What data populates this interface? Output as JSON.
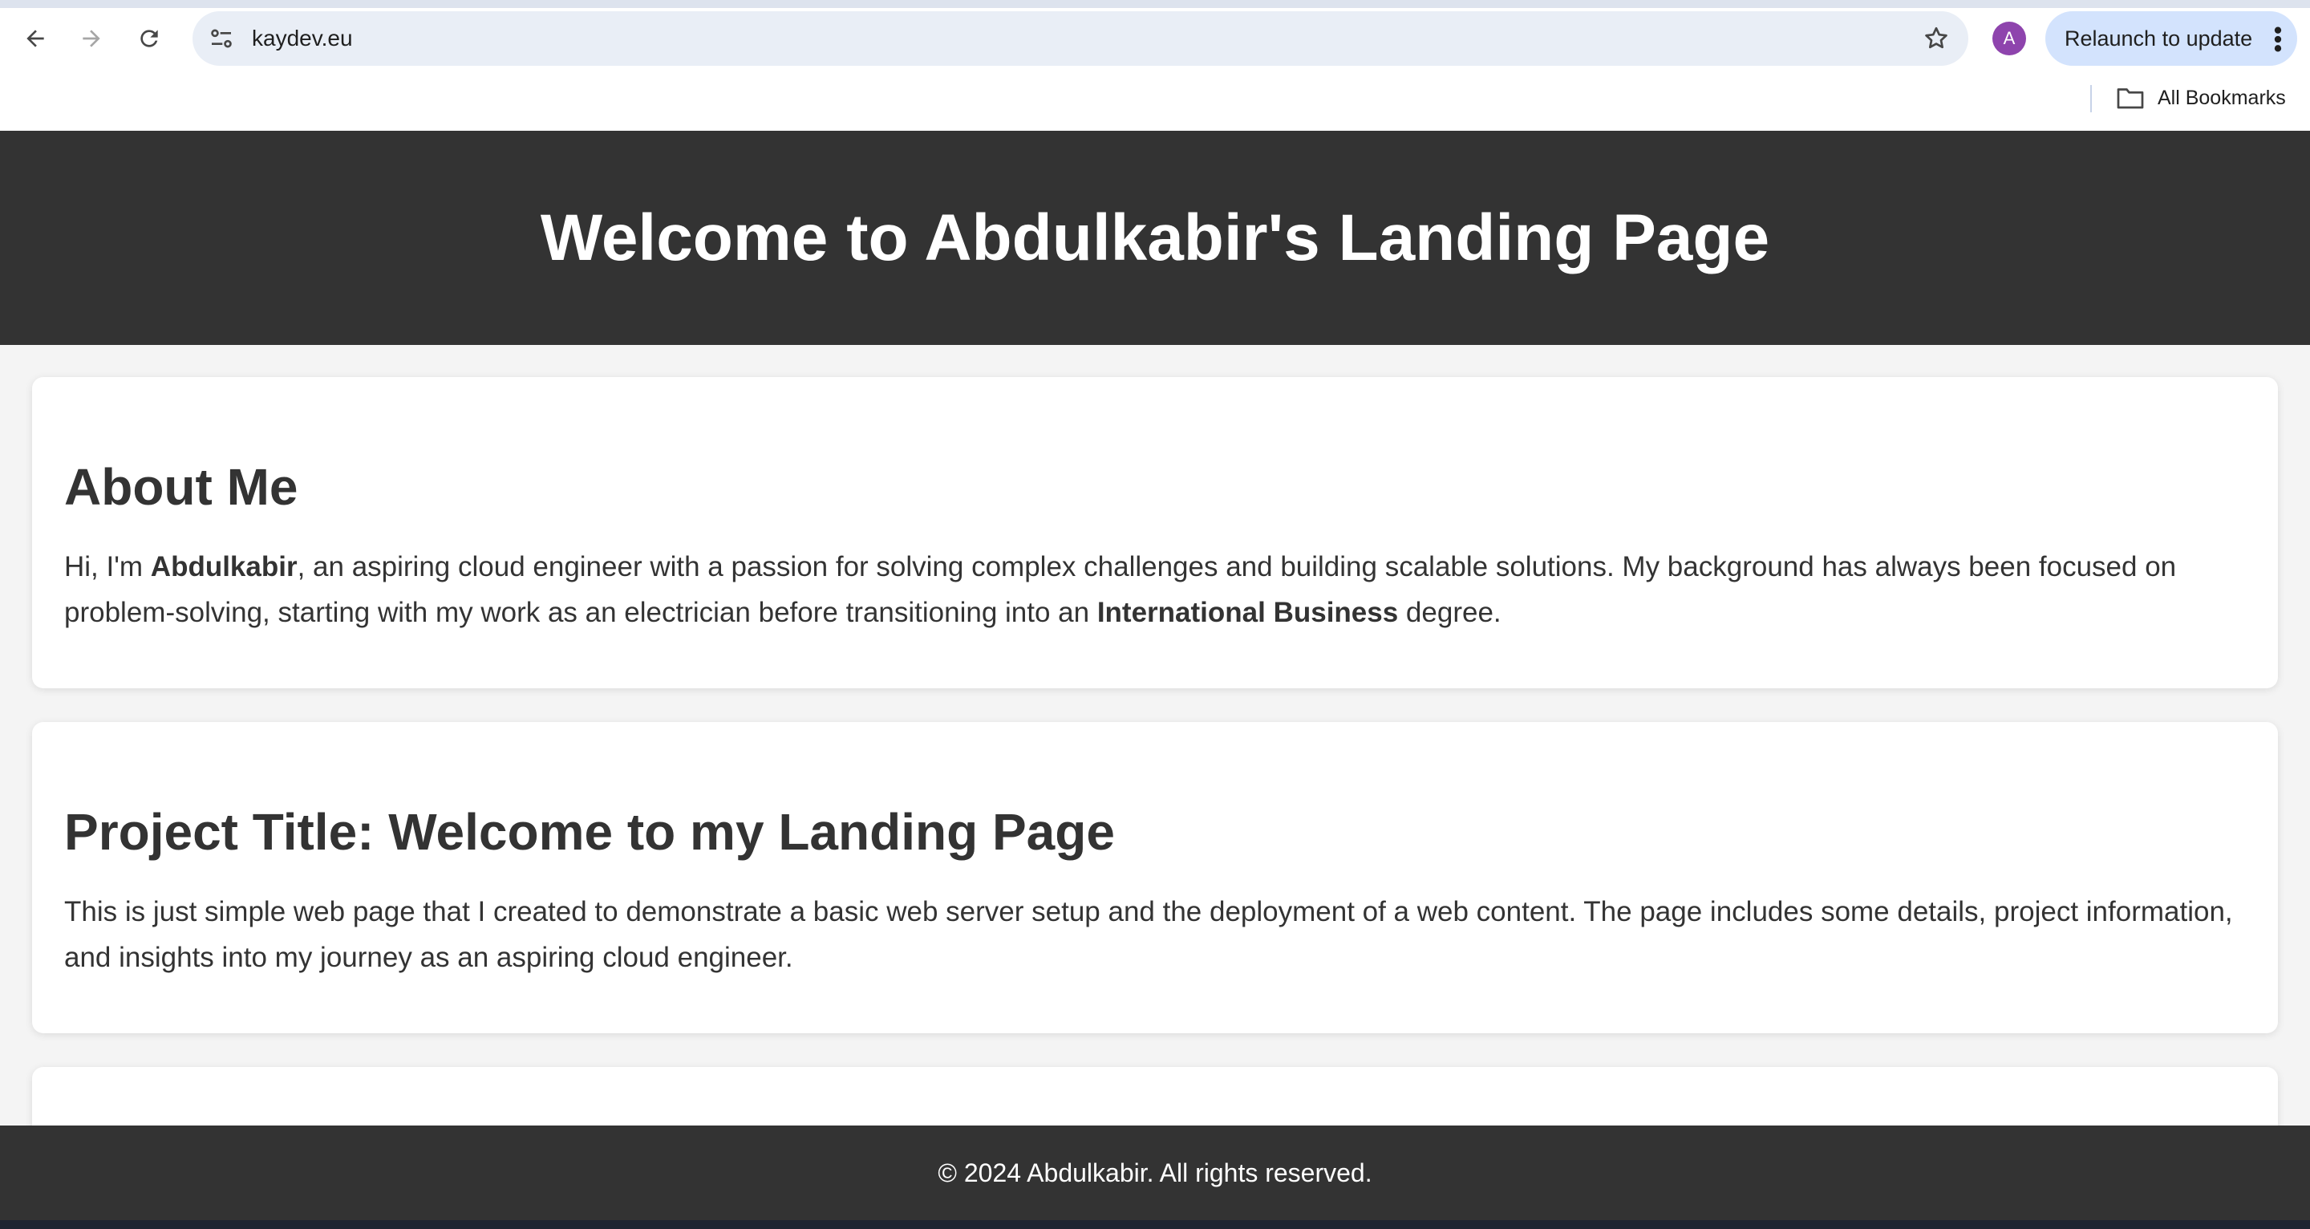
{
  "browser": {
    "url": "kaydev.eu",
    "profile_initial": "A",
    "relaunch_label": "Relaunch to update",
    "bookmarks_label": "All Bookmarks"
  },
  "page": {
    "header_title": "Welcome to Abdulkabir's Landing Page",
    "about": {
      "heading": "About Me",
      "text_1": "Hi, I'm ",
      "name_bold": "Abdulkabir",
      "text_2": ", an aspiring cloud engineer with a passion for solving complex challenges and building scalable solutions. My background has always been focused on problem-solving, starting with my work as an electrician before transitioning into an ",
      "degree_bold": "International Business",
      "text_3": " degree."
    },
    "project": {
      "heading": "Project Title: Welcome to my Landing Page",
      "text": "This is just simple web page that I created to demonstrate a basic web server setup and the deployment of a web content. The page includes some details, project information, and insights into my journey as an aspiring cloud engineer."
    },
    "footer": "© 2024 Abdulkabir. All rights reserved."
  },
  "colors": {
    "header_bg": "#333333",
    "page_bg": "#f4f4f4",
    "card_bg": "#ffffff",
    "text": "#333333",
    "omnibox_bg": "#e9eef6",
    "relaunch_bg": "#d3e3fd",
    "avatar_bg": "#8e44ad"
  },
  "icons": [
    "back-icon",
    "forward-icon",
    "reload-icon",
    "site-settings-icon",
    "bookmark-star-icon",
    "kebab-menu-icon",
    "folder-icon"
  ]
}
